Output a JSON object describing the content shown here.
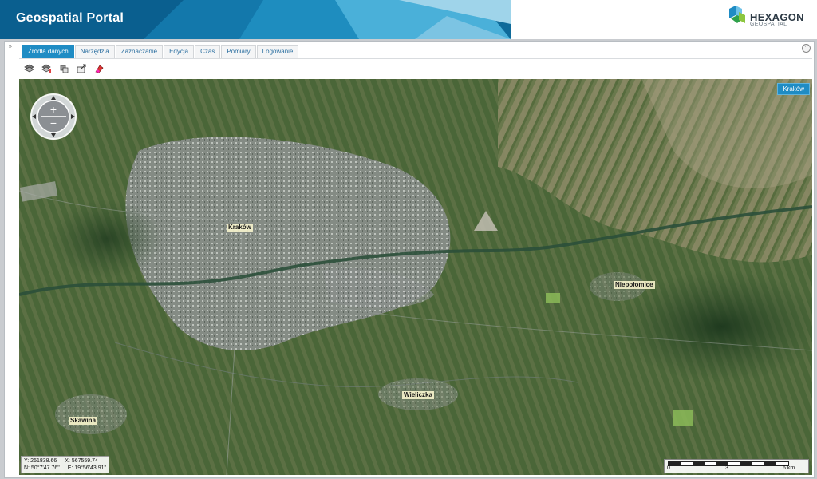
{
  "app": {
    "title": "Geospatial Portal"
  },
  "logo": {
    "name": "HEXAGON",
    "sub": "GEOSPATIAL"
  },
  "tabs": [
    {
      "label": "Źródła danych",
      "active": true
    },
    {
      "label": "Narzędzia",
      "active": false
    },
    {
      "label": "Zaznaczanie",
      "active": false
    },
    {
      "label": "Edycja",
      "active": false
    },
    {
      "label": "Czas",
      "active": false
    },
    {
      "label": "Pomiary",
      "active": false
    },
    {
      "label": "Logowanie",
      "active": false
    }
  ],
  "toolbar": {
    "icons": [
      "layers-add-icon",
      "layers-edit-icon",
      "layers-link-icon",
      "export-icon",
      "clear-icon"
    ]
  },
  "map": {
    "location_badge": "Kraków",
    "places": {
      "krakow": "Kraków",
      "niepolomice": "Niepołomice",
      "wieliczka": "Wieliczka",
      "skawina": "Skawina"
    },
    "coordinates": {
      "y": "Y: 251838.66",
      "x": "X: 567559.74",
      "n": "N: 50°7'47.76\"",
      "e": "E: 19°56'43.91\""
    },
    "scale": {
      "start": "0",
      "mid": "3",
      "end": "6 km"
    }
  },
  "colors": {
    "accent": "#1f8cc4",
    "header_bg": "#ffffff",
    "banner_dark": "#0e6a9a"
  }
}
